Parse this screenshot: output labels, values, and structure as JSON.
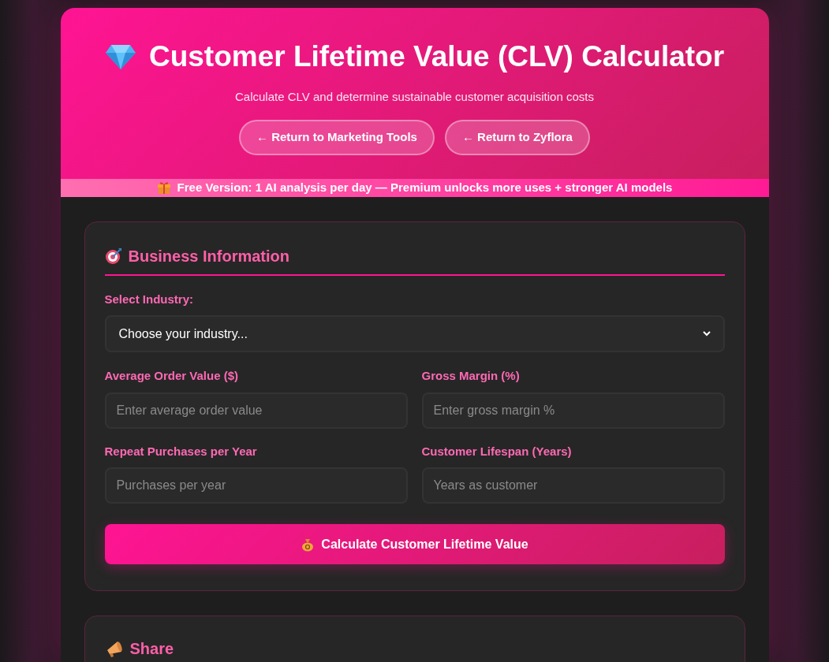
{
  "header": {
    "title": "Customer Lifetime Value (CLV) Calculator",
    "subtitle": "Calculate CLV and determine sustainable customer acquisition costs",
    "links": [
      {
        "label": "← Return to Marketing Tools"
      },
      {
        "label": "← Return to Zyflora"
      }
    ]
  },
  "banner": {
    "text": "Free Version: 1 AI analysis per day — Premium unlocks more uses + stronger AI models"
  },
  "business_information": {
    "title": "Business Information",
    "industry": {
      "label": "Select Industry:",
      "value": "Choose your industry..."
    },
    "fields": [
      {
        "label": "Average Order Value ($)",
        "placeholder": "Enter average order value"
      },
      {
        "label": "Gross Margin (%)",
        "placeholder": "Enter gross margin %"
      },
      {
        "label": "Repeat Purchases per Year",
        "placeholder": "Purchases per year"
      },
      {
        "label": "Customer Lifespan (Years)",
        "placeholder": "Years as customer"
      }
    ],
    "button": "Calculate Customer Lifetime Value"
  },
  "share": {
    "title": "Share"
  }
}
